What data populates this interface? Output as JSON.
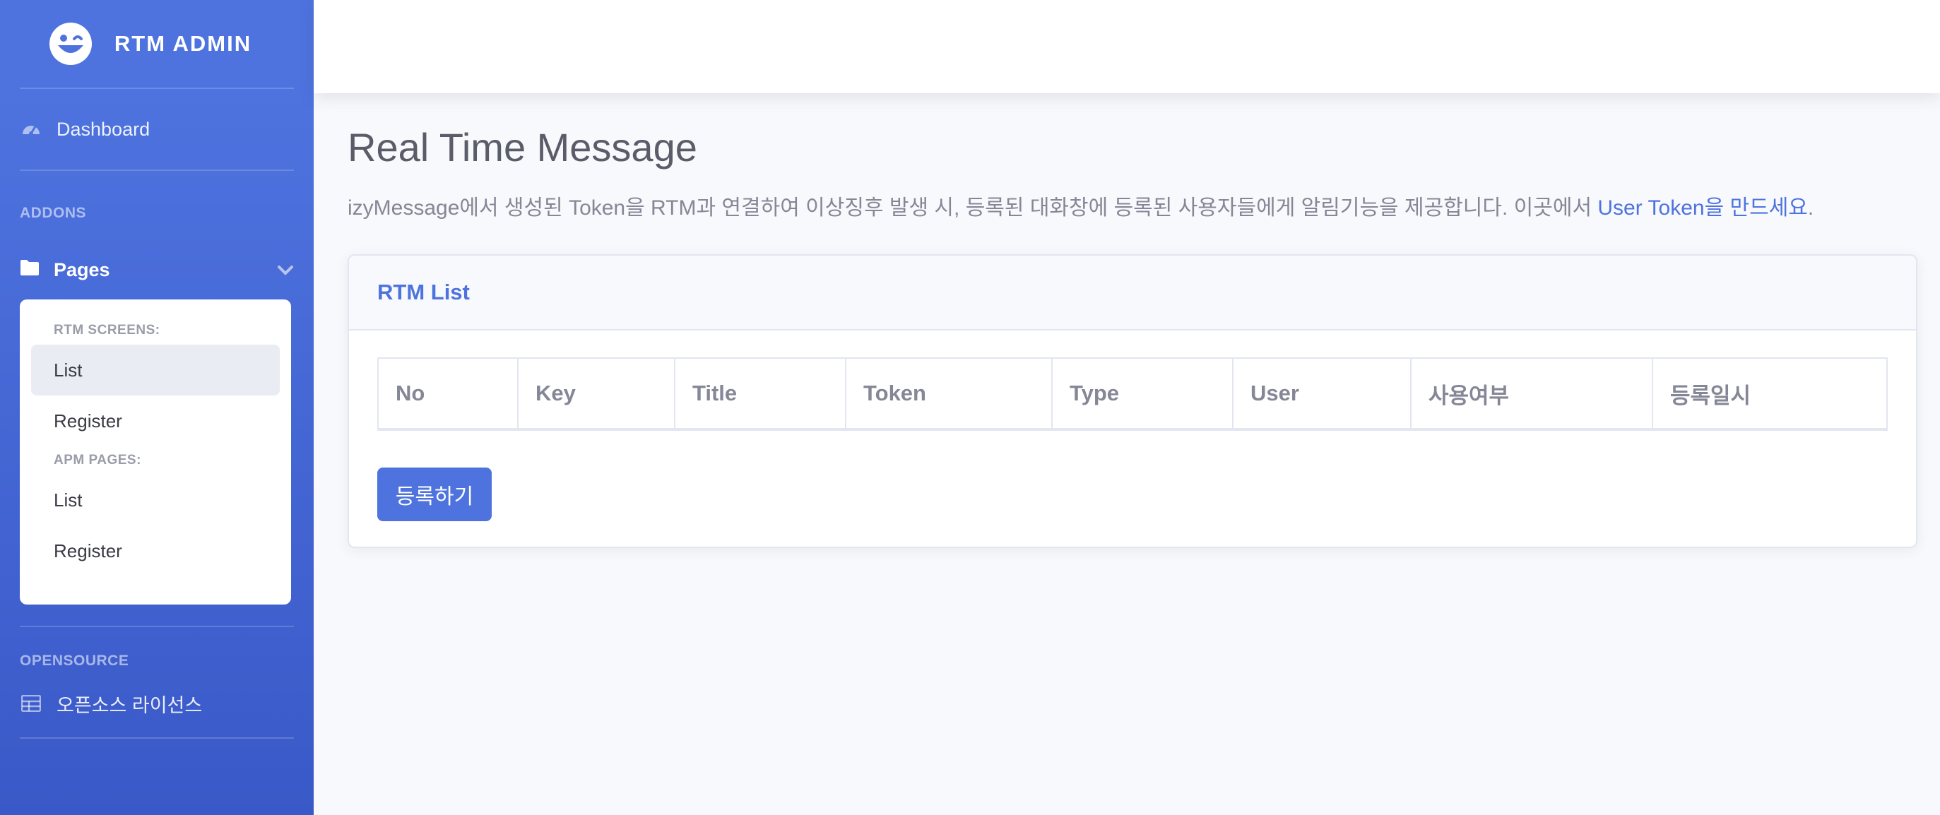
{
  "sidebar": {
    "brand": "RTM ADMIN",
    "dashboard_label": "Dashboard",
    "addons_heading": "ADDONS",
    "pages_label": "Pages",
    "collapse": {
      "rtm_heading": "RTM SCREENS:",
      "rtm_items": [
        "List",
        "Register"
      ],
      "apm_heading": "APM PAGES:",
      "apm_items": [
        "List",
        "Register"
      ]
    },
    "opensource_heading": "OPENSOURCE",
    "license_label": "오픈소스 라이선스"
  },
  "main": {
    "title": "Real Time Message",
    "description": "izyMessage에서 생성된 Token을 RTM과 연결하여 이상징후 발생 시, 등록된 대화창에 등록된 사용자들에게 알림기능을 제공합니다. 이곳에서 ",
    "description_link": "User Token을 만드세요",
    "description_end": "."
  },
  "card": {
    "title": "RTM List",
    "columns": [
      "No",
      "Key",
      "Title",
      "Token",
      "Type",
      "User",
      "사용여부",
      "등록일시"
    ],
    "register_button": "등록하기"
  },
  "colors": {
    "primary": "#4e73df",
    "background": "#f8f9fc"
  }
}
